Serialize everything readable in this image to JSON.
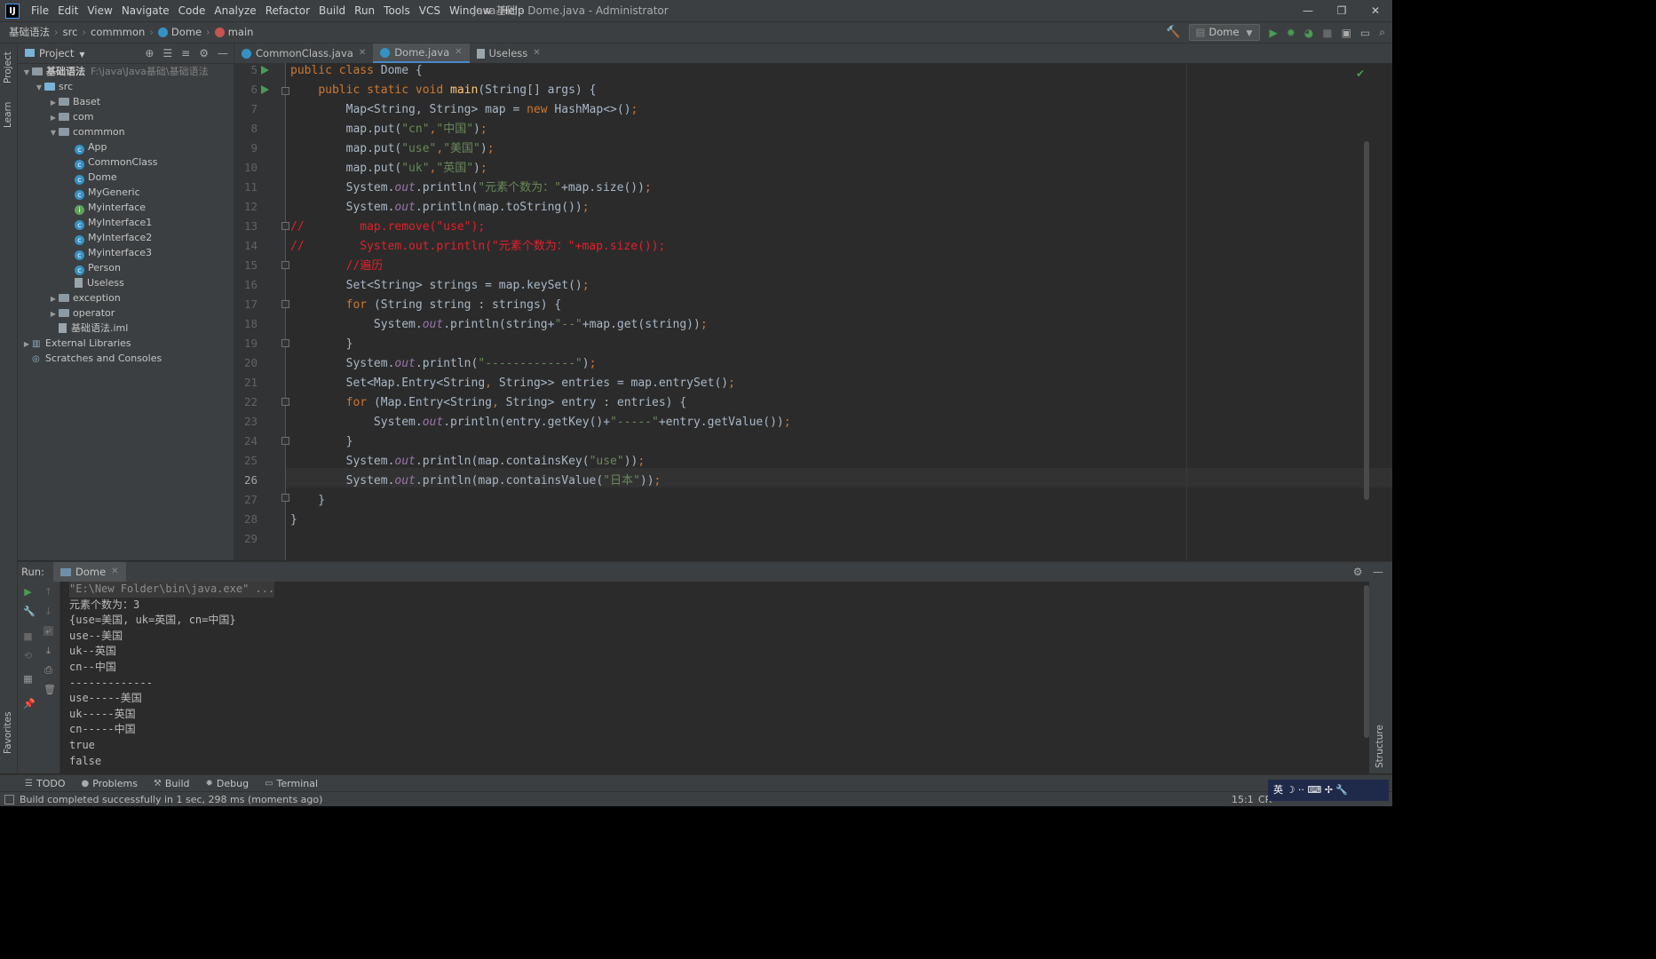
{
  "titlebar": {
    "menu": [
      "File",
      "Edit",
      "View",
      "Navigate",
      "Code",
      "Analyze",
      "Refactor",
      "Build",
      "Run",
      "Tools",
      "VCS",
      "Window",
      "Help"
    ],
    "title": "Java基础 - Dome.java - Administrator",
    "controls": [
      "—",
      "❐",
      "✕"
    ]
  },
  "breadcrumb": {
    "project": "基础语法",
    "src": "src",
    "pkg": "commmon",
    "cls": "Dome",
    "method": "main"
  },
  "toolbar_top": {
    "run_config": "Dome"
  },
  "left_strip": {
    "project": "Project",
    "learn": "Learn",
    "favorites": "Favorites"
  },
  "project_panel": {
    "title": "Project",
    "root": "基础语法",
    "root_path": "F:\\java\\Java基础\\基础语法",
    "src": "src",
    "folders_top": [
      "Baset",
      "com"
    ],
    "pkg": "commmon",
    "classes": [
      {
        "name": "App",
        "kind": "class"
      },
      {
        "name": "CommonClass",
        "kind": "class"
      },
      {
        "name": "Dome",
        "kind": "class"
      },
      {
        "name": "MyGeneric",
        "kind": "class"
      },
      {
        "name": "Myinterface",
        "kind": "interface"
      },
      {
        "name": "MyInterface1",
        "kind": "class"
      },
      {
        "name": "MyInterface2",
        "kind": "class"
      },
      {
        "name": "Myinterface3",
        "kind": "class"
      },
      {
        "name": "Person",
        "kind": "class"
      },
      {
        "name": "Useless",
        "kind": "file"
      }
    ],
    "folders_bottom": [
      "exception",
      "operator"
    ],
    "iml": "基础语法.iml",
    "ext": "External Libraries",
    "scratch": "Scratches and Consoles"
  },
  "tabs": [
    {
      "label": "CommonClass.java",
      "active": false
    },
    {
      "label": "Dome.java",
      "active": true
    },
    {
      "label": "Useless",
      "active": false
    }
  ],
  "editor": {
    "line_numbers": [
      "5",
      "6",
      "7",
      "8",
      "9",
      "10",
      "11",
      "12",
      "13",
      "14",
      "15",
      "16",
      "17",
      "18",
      "19",
      "20",
      "21",
      "22",
      "23",
      "24",
      "25",
      "26",
      "27",
      "28",
      "29"
    ],
    "current_line": "26"
  },
  "run_panel": {
    "label": "Run:",
    "tab": "Dome",
    "output": [
      "\"E:\\New Folder\\bin\\java.exe\" ...",
      "元素个数为：3",
      "{use=美国, uk=英国, cn=中国}",
      "use--美国",
      "uk--英国",
      "cn--中国",
      "-------------",
      "use-----美国",
      "uk-----英国",
      "cn-----中国",
      "true",
      "false"
    ]
  },
  "bottom_tools": [
    "TODO",
    "Problems",
    "Build",
    "Debug",
    "Terminal"
  ],
  "status": {
    "message": "Build completed successfully in 1 sec, 298 ms (moments ago)",
    "position": "15:1",
    "encoding": "CR"
  },
  "right_strip": {
    "structure": "Structure"
  },
  "ime": "英 ☽ ·· ⌨ ✢ 🔧"
}
